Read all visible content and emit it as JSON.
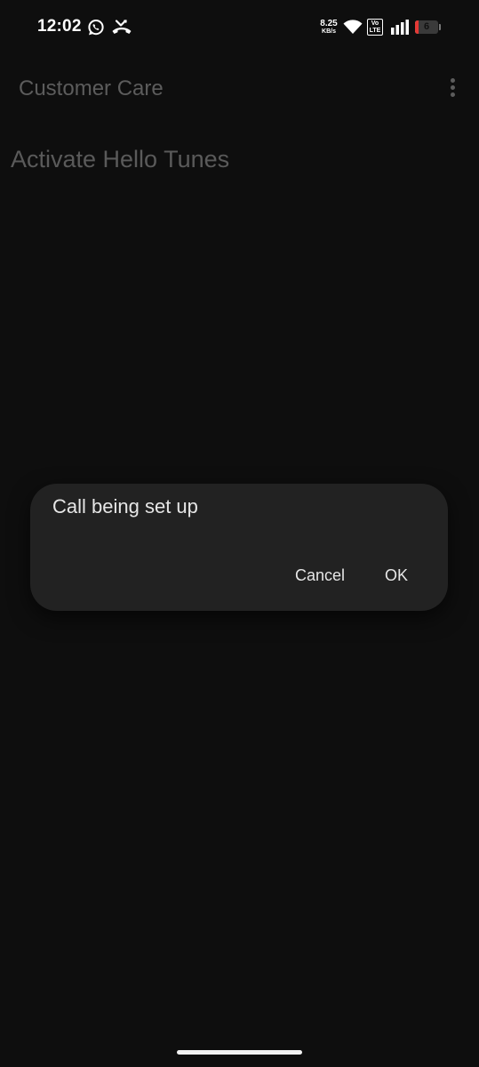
{
  "status_bar": {
    "time": "12:02",
    "icons": [
      "whatsapp-icon",
      "missed-call-icon",
      "wifi-icon",
      "signal-icon"
    ],
    "network_speed": "8.25",
    "network_speed_unit": "KB/s",
    "volte_top": "Vo",
    "volte_bottom": "LTE",
    "battery_level": "6",
    "battery_fraction": 0.06
  },
  "app_bar": {
    "title": "Customer Care",
    "menu_icon": "more-vertical-icon"
  },
  "content": {
    "heading": "Activate Hello Tunes"
  },
  "dialog": {
    "message": "Call being set up",
    "cancel_label": "Cancel",
    "ok_label": "OK"
  },
  "colors": {
    "background": "#0e0e0e",
    "dialog_background": "#222222",
    "dimmed_text": "#5c5c5c",
    "dialog_text": "#e6e6e6"
  }
}
